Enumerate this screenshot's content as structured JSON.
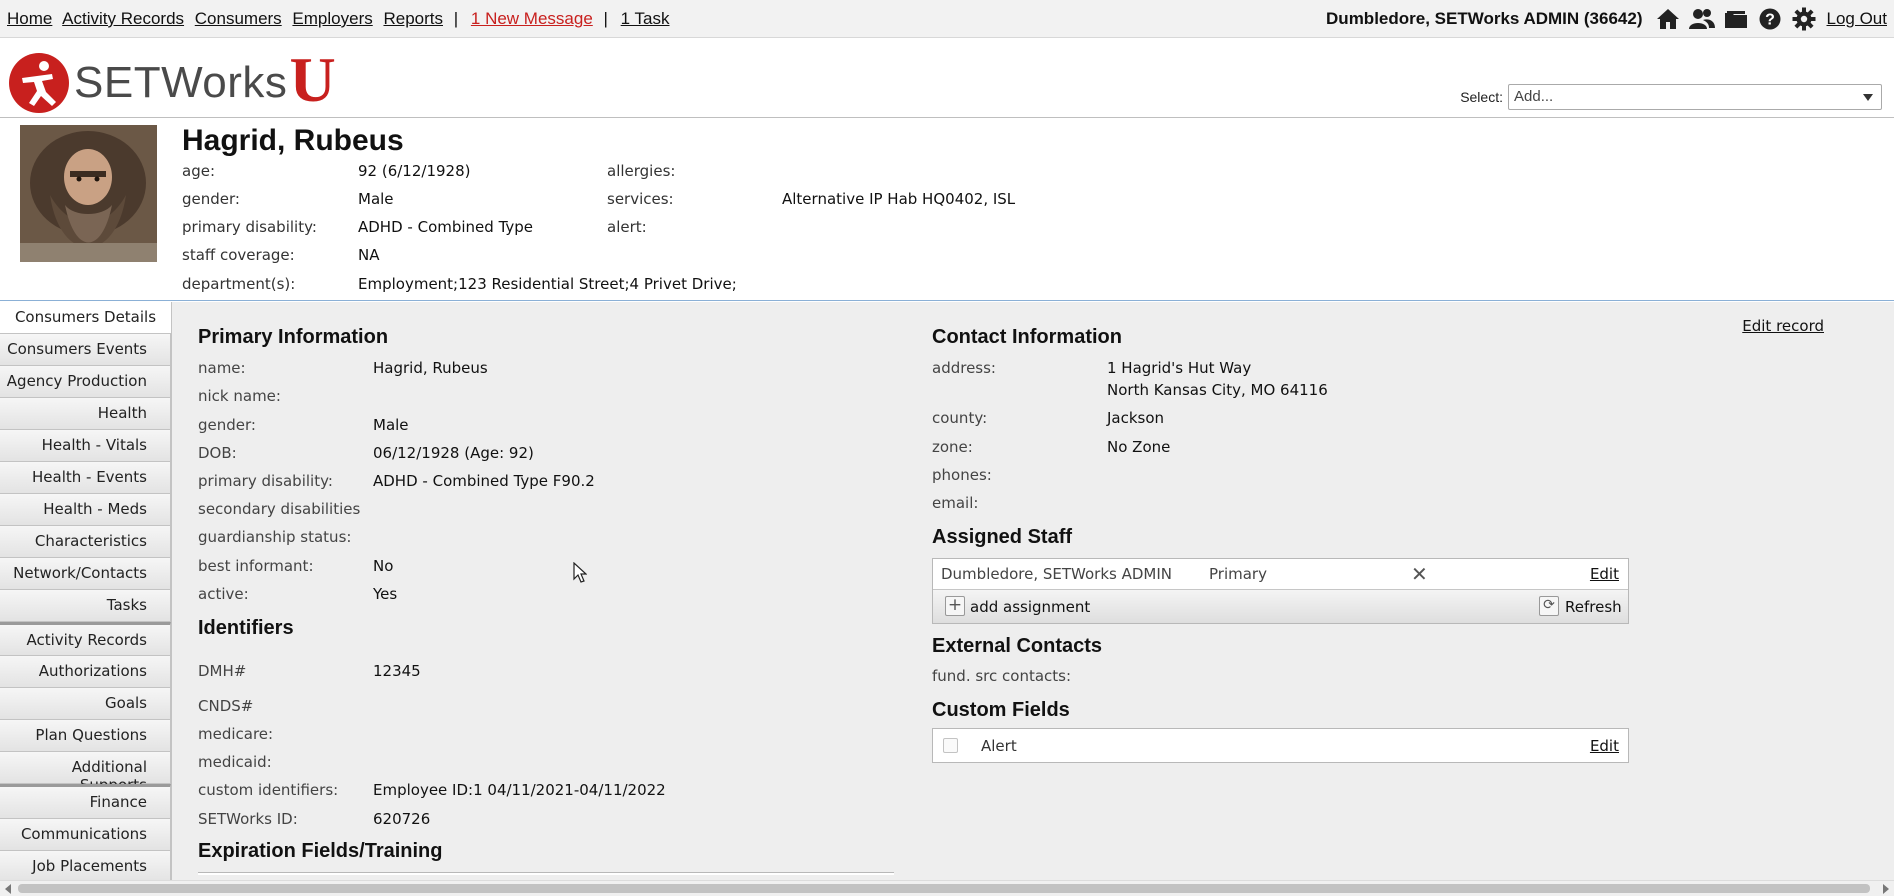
{
  "topnav": {
    "links": [
      "Home",
      "Activity Records",
      "Consumers",
      "Employers",
      "Reports"
    ],
    "separator": "|",
    "message_link": "1 New Message",
    "task_link": "1 Task",
    "user": "Dumbledore, SETWorks ADMIN  (36642)",
    "logout": "Log Out",
    "icons": [
      "home-icon",
      "users-icon",
      "folder-icon",
      "help-icon",
      "gear-icon"
    ]
  },
  "logo": {
    "text": "SETWorks",
    "suffix": "U",
    "brand_color": "#c8201e"
  },
  "select": {
    "label": "Select:",
    "value": "Add..."
  },
  "consumer": {
    "name": "Hagrid, Rubeus",
    "left_fields": [
      {
        "label": "age:",
        "value": "92 (6/12/1928)"
      },
      {
        "label": "gender:",
        "value": "Male"
      },
      {
        "label": "primary disability:",
        "value": "ADHD - Combined Type"
      },
      {
        "label": "staff coverage:",
        "value": "NA"
      },
      {
        "label": "department(s):",
        "value": "Employment;123 Residential Street;4 Privet Drive;"
      }
    ],
    "right_fields": [
      {
        "label": "allergies:",
        "value": ""
      },
      {
        "label": "services:",
        "value": "Alternative IP Hab HQ0402, ISL"
      },
      {
        "label": "alert:",
        "value": ""
      }
    ]
  },
  "sidenav": {
    "items": [
      "Consumers Details",
      "Consumers Events",
      "Agency Production",
      "Health",
      "Health - Vitals",
      "Health - Events",
      "Health - Meds",
      "Characteristics",
      "Network/Contacts",
      "Tasks",
      "Activity Records",
      "Authorizations",
      "Goals",
      "Plan Questions",
      "Additional Supports",
      "Finance",
      "Communications",
      "Job Placements"
    ],
    "active": "Consumers Details"
  },
  "main": {
    "edit_record": "Edit record",
    "primary": {
      "title": "Primary Information",
      "fields": [
        {
          "label": "name:",
          "value": "Hagrid, Rubeus"
        },
        {
          "label": "nick name:",
          "value": ""
        },
        {
          "label": "gender:",
          "value": "Male"
        },
        {
          "label": "DOB:",
          "value": "06/12/1928 (Age: 92)"
        },
        {
          "label": "primary disability:",
          "value": "ADHD - Combined Type F90.2"
        },
        {
          "label": "secondary disabilities",
          "value": ""
        },
        {
          "label": "guardianship status:",
          "value": ""
        },
        {
          "label": "best informant:",
          "value": "No"
        },
        {
          "label": "active:",
          "value": "Yes"
        }
      ]
    },
    "identifiers": {
      "title": "Identifiers",
      "fields": [
        {
          "label": "DMH#",
          "value": "12345"
        },
        {
          "label": "CNDS#",
          "value": ""
        },
        {
          "label": "medicare:",
          "value": ""
        },
        {
          "label": "medicaid:",
          "value": ""
        },
        {
          "label": "custom identifiers:",
          "value": "Employee ID:1 04/11/2021-04/11/2022"
        },
        {
          "label": "SETWorks ID:",
          "value": "620726"
        }
      ]
    },
    "expiration_title": "Expiration Fields/Training",
    "contact": {
      "title": "Contact Information",
      "address_label": "address:",
      "address_line1": "1 Hagrid's Hut Way",
      "address_line2": "North Kansas City, MO 64116",
      "fields": [
        {
          "label": "county:",
          "value": "Jackson"
        },
        {
          "label": "zone:",
          "value": "No Zone"
        },
        {
          "label": "phones:",
          "value": ""
        },
        {
          "label": "email:",
          "value": ""
        }
      ]
    },
    "assigned_staff": {
      "title": "Assigned Staff",
      "staff_name": "Dumbledore, SETWorks ADMIN",
      "role": "Primary",
      "edit": "Edit",
      "add": "add assignment",
      "refresh": "Refresh"
    },
    "external": {
      "title": "External Contacts",
      "label": "fund. src contacts:"
    },
    "custom_fields": {
      "title": "Custom Fields",
      "field": "Alert",
      "edit": "Edit"
    }
  }
}
